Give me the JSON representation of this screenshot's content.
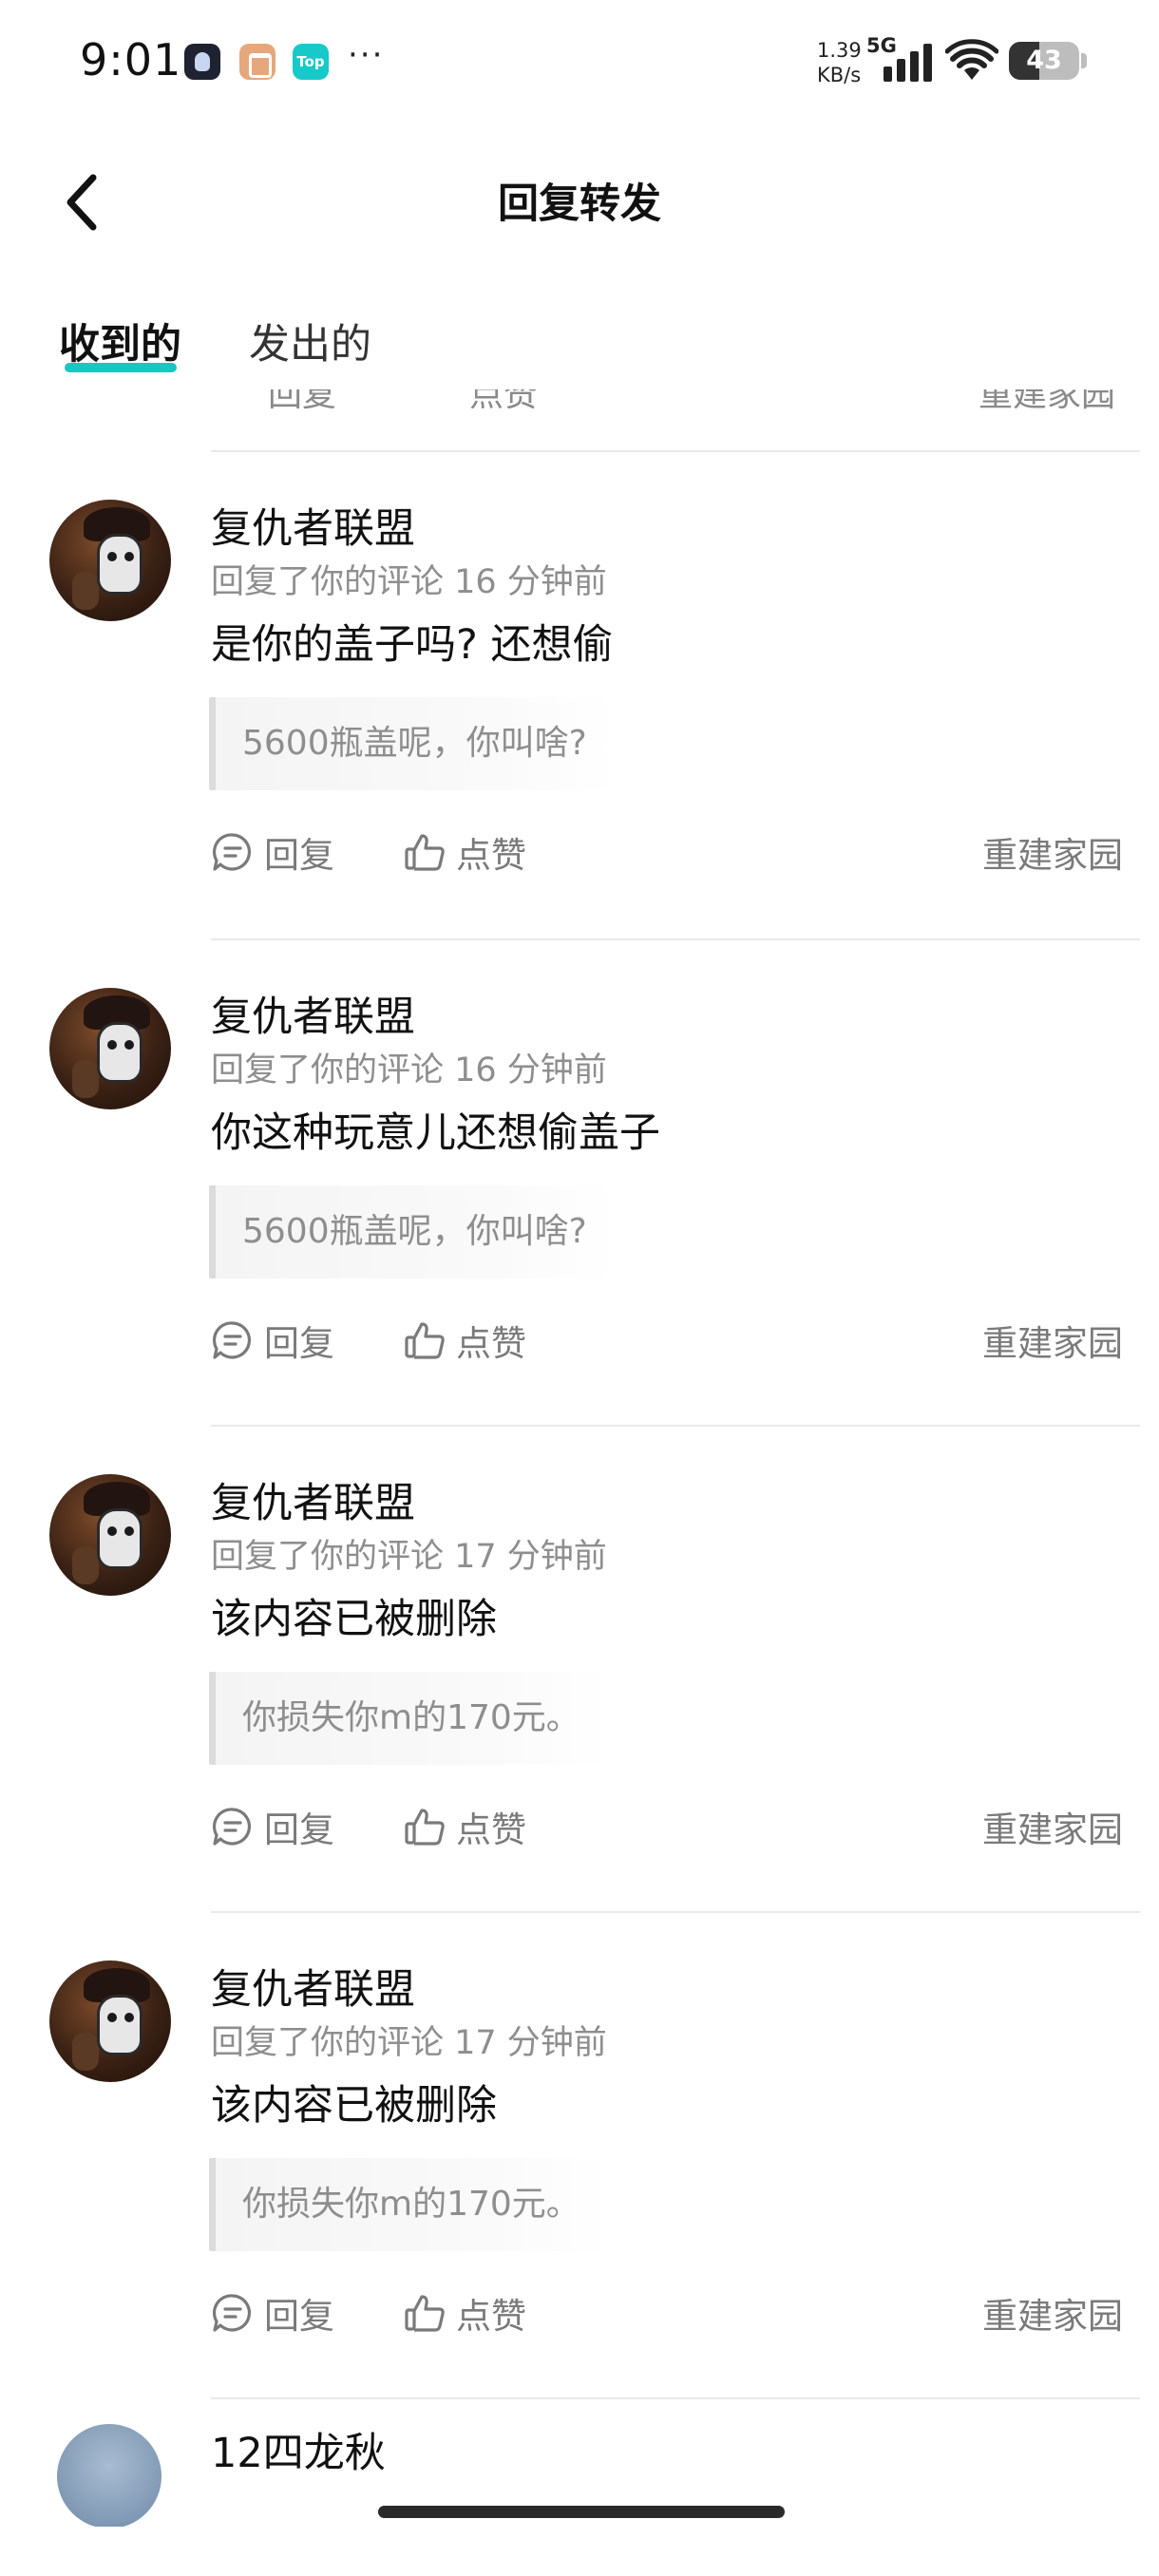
{
  "status_bar": {
    "time": "9:01",
    "notif_app_3": "Top",
    "overflow": "···",
    "net_speed_value": "1.39",
    "net_speed_unit": "KB/s",
    "network": "5G",
    "battery": "43",
    "battery_level": 0.43
  },
  "header": {
    "title": "回复转发",
    "back_icon": "chevron-left-icon"
  },
  "tabs": [
    {
      "label": "收到的",
      "active": true
    },
    {
      "label": "发出的",
      "active": false
    }
  ],
  "partial_top_row": {
    "reply_label": "回复",
    "like_label": "点赞",
    "topic": "重建家园"
  },
  "items": [
    {
      "username": "复仇者联盟",
      "meta": "回复了你的评论 16 分钟前",
      "content": "是你的盖子吗? 还想偷",
      "quote": "5600瓶盖呢，你叫啥?",
      "reply_label": "回复",
      "like_label": "点赞",
      "topic": "重建家园"
    },
    {
      "username": "复仇者联盟",
      "meta": "回复了你的评论 16 分钟前",
      "content": "你这种玩意儿还想偷盖子",
      "quote": "5600瓶盖呢，你叫啥?",
      "reply_label": "回复",
      "like_label": "点赞",
      "topic": "重建家园"
    },
    {
      "username": "复仇者联盟",
      "meta": "回复了你的评论 17 分钟前",
      "content": "该内容已被删除",
      "quote": "你损失你m的170元。",
      "reply_label": "回复",
      "like_label": "点赞",
      "topic": "重建家园"
    },
    {
      "username": "复仇者联盟",
      "meta": "回复了你的评论 17 分钟前",
      "content": "该内容已被删除",
      "quote": "你损失你m的170元。",
      "reply_label": "回复",
      "like_label": "点赞",
      "topic": "重建家园"
    }
  ],
  "next_item_peek": {
    "username": "12四龙秋"
  },
  "colors": {
    "accent": "#19c6c0",
    "muted_text": "#8e8e8e",
    "divider": "#e9e9e9"
  }
}
